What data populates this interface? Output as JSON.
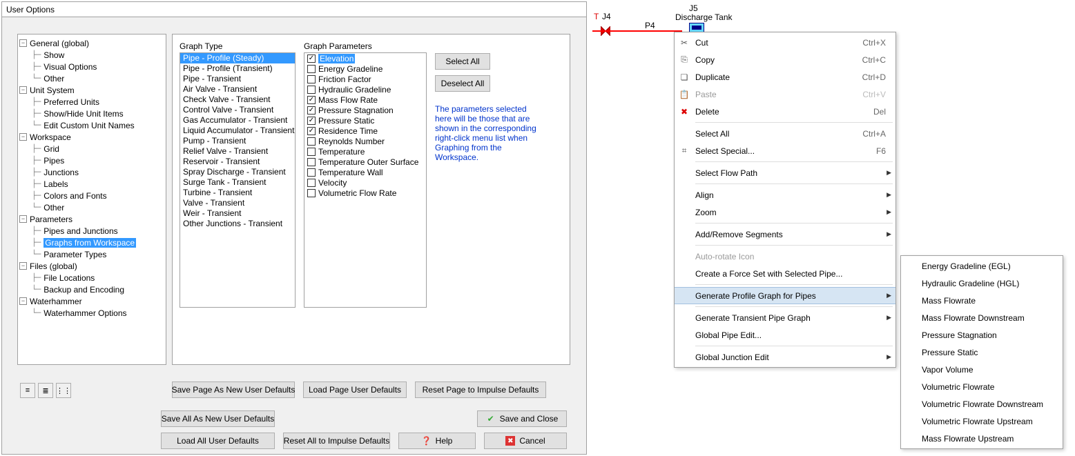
{
  "dialog": {
    "title": "User Options",
    "tree": {
      "general": "General (global)",
      "show": "Show",
      "visual_options": "Visual Options",
      "other1": "Other",
      "unit_system": "Unit System",
      "preferred_units": "Preferred Units",
      "show_hide_unit": "Show/Hide Unit Items",
      "edit_custom_unit": "Edit Custom Unit Names",
      "workspace": "Workspace",
      "grid": "Grid",
      "pipes": "Pipes",
      "junctions": "Junctions",
      "labels": "Labels",
      "colors_fonts": "Colors and Fonts",
      "other2": "Other",
      "parameters": "Parameters",
      "pipes_junctions": "Pipes and Junctions",
      "graphs_from_workspace": "Graphs from Workspace",
      "parameter_types": "Parameter Types",
      "files": "Files (global)",
      "file_locations": "File Locations",
      "backup_encoding": "Backup and Encoding",
      "waterhammer": "Waterhammer",
      "waterhammer_options": "Waterhammer Options"
    },
    "graph_type_label": "Graph Type",
    "graph_types": [
      "Pipe - Profile (Steady)",
      "Pipe - Profile (Transient)",
      "Pipe - Transient",
      "Air Valve - Transient",
      "Check Valve - Transient",
      "Control Valve - Transient",
      "Gas Accumulator - Transient",
      "Liquid Accumulator - Transient",
      "Pump - Transient",
      "Relief Valve - Transient",
      "Reservoir - Transient",
      "Spray Discharge - Transient",
      "Surge Tank - Transient",
      "Turbine - Transient",
      "Valve - Transient",
      "Weir - Transient",
      "Other Junctions - Transient"
    ],
    "graph_parameters_label": "Graph Parameters",
    "graph_parameters": [
      {
        "label": "Elevation",
        "c": true,
        "s": true
      },
      {
        "label": "Energy Gradeline",
        "c": false
      },
      {
        "label": "Friction Factor",
        "c": false
      },
      {
        "label": "Hydraulic Gradeline",
        "c": false
      },
      {
        "label": "Mass Flow Rate",
        "c": true
      },
      {
        "label": "Pressure Stagnation",
        "c": true
      },
      {
        "label": "Pressure Static",
        "c": true
      },
      {
        "label": "Residence Time",
        "c": true
      },
      {
        "label": "Reynolds Number",
        "c": false
      },
      {
        "label": "Temperature",
        "c": false
      },
      {
        "label": "Temperature Outer Surface",
        "c": false
      },
      {
        "label": "Temperature Wall",
        "c": false
      },
      {
        "label": "Velocity",
        "c": false
      },
      {
        "label": "Volumetric Flow Rate",
        "c": false
      }
    ],
    "select_all": "Select All",
    "deselect_all": "Deselect All",
    "help_text": "The parameters selected here will be those that are shown in the corresponding right-click menu list when Graphing from the Workspace.",
    "buttons": {
      "save_page_defaults": "Save Page As New User Defaults",
      "load_page_defaults": "Load Page User Defaults",
      "reset_page_defaults": "Reset Page to Impulse Defaults",
      "save_all_defaults": "Save All As New User Defaults",
      "save_close": "Save and Close",
      "load_all_defaults": "Load All User Defaults",
      "reset_all_defaults": "Reset All to Impulse Defaults",
      "help": "Help",
      "cancel": "Cancel"
    }
  },
  "workspace": {
    "j_prefix": "T",
    "j4": "J4",
    "j5": "J5",
    "tank_label": "Discharge Tank",
    "p4": "P4"
  },
  "context_menu": [
    {
      "label": "Cut",
      "shortcut": "Ctrl+X",
      "icon": "✂"
    },
    {
      "label": "Copy",
      "shortcut": "Ctrl+C",
      "icon": "⎘"
    },
    {
      "label": "Duplicate",
      "shortcut": "Ctrl+D",
      "icon": "❏"
    },
    {
      "label": "Paste",
      "shortcut": "Ctrl+V",
      "icon": "📋",
      "disabled": true
    },
    {
      "label": "Delete",
      "shortcut": "Del",
      "icon": "✖",
      "icon_color": "#d00"
    },
    {
      "label": "Select All",
      "shortcut": "Ctrl+A"
    },
    {
      "label": "Select Special...",
      "shortcut": "F6",
      "icon": "⌗"
    },
    {
      "label": "Select Flow Path",
      "submenu": true
    },
    {
      "label": "Align",
      "submenu": true
    },
    {
      "label": "Zoom",
      "submenu": true
    },
    {
      "label": "Add/Remove Segments",
      "submenu": true
    },
    {
      "label": "Auto-rotate Icon",
      "disabled": true
    },
    {
      "label": "Create a Force Set with Selected Pipe..."
    },
    {
      "label": "Generate Profile Graph for Pipes",
      "submenu": true,
      "selected": true
    },
    {
      "label": "Generate Transient Pipe Graph",
      "submenu": true
    },
    {
      "label": "Global Pipe Edit..."
    },
    {
      "label": "Global Junction Edit",
      "submenu": true
    }
  ],
  "submenu": [
    "Energy Gradeline (EGL)",
    "Hydraulic Gradeline (HGL)",
    "Mass Flowrate",
    "Mass Flowrate Downstream",
    "Pressure Stagnation",
    "Pressure Static",
    "Vapor Volume",
    "Volumetric Flowrate",
    "Volumetric Flowrate Downstream",
    "Volumetric Flowrate Upstream",
    "Mass Flowrate Upstream"
  ]
}
